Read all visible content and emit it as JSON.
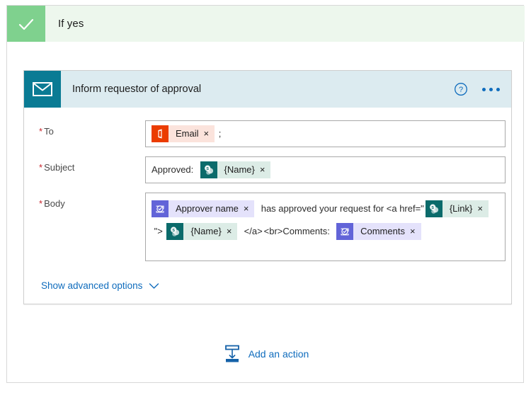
{
  "scope": {
    "title": "If yes",
    "check_icon": "checkmark-icon",
    "accent_green": "#7fd18e",
    "header_bg": "#edf7ed"
  },
  "card": {
    "title": "Inform requestor of approval",
    "icon": "envelope-icon",
    "icon_bg": "#0a7b94",
    "header_bg": "#dcebf0",
    "help_icon": "help-circle-icon",
    "more_icon": "ellipsis-icon"
  },
  "fields": [
    {
      "label": "To",
      "required_marker": "*",
      "name": "to",
      "tokens": [
        {
          "text": "Email",
          "close": "×",
          "kind": "office",
          "icon": "office365-outlook-icon"
        }
      ],
      "trailing_text": " ;"
    },
    {
      "label": "Subject",
      "required_marker": "*",
      "name": "subject",
      "leading_text": "Approved:  ",
      "tokens": [
        {
          "text": "{Name}",
          "close": "×",
          "kind": "sharepoint",
          "icon": "sharepoint-icon"
        }
      ]
    }
  ],
  "body_field": {
    "label": "Body",
    "required_marker": "*",
    "lines": [
      {
        "parts": [
          {
            "type": "token",
            "kind": "approvals",
            "icon": "approvals-icon",
            "text": "Approver name",
            "close": "×"
          },
          {
            "type": "text",
            "text": "  has approved your request for <a href=\""
          }
        ]
      },
      {
        "parts": [
          {
            "type": "token",
            "kind": "sharepoint",
            "icon": "sharepoint-icon",
            "text": "{Link}",
            "close": "×"
          },
          {
            "type": "text",
            "text": " \"> "
          },
          {
            "type": "token",
            "kind": "sharepoint",
            "icon": "sharepoint-icon",
            "text": "{Name}",
            "close": "×"
          },
          {
            "type": "text",
            "text": "  </a>"
          }
        ]
      },
      {
        "parts": [
          {
            "type": "text",
            "text": "<br>Comments:  "
          },
          {
            "type": "token",
            "kind": "approvals",
            "icon": "approvals-icon",
            "text": "Comments",
            "close": "×"
          }
        ]
      }
    ]
  },
  "advanced": {
    "label": "Show advanced options",
    "chevron_icon": "chevron-down-icon"
  },
  "add_action": {
    "label": "Add an action",
    "icon": "insert-action-icon",
    "color": "#0f6cbd"
  }
}
